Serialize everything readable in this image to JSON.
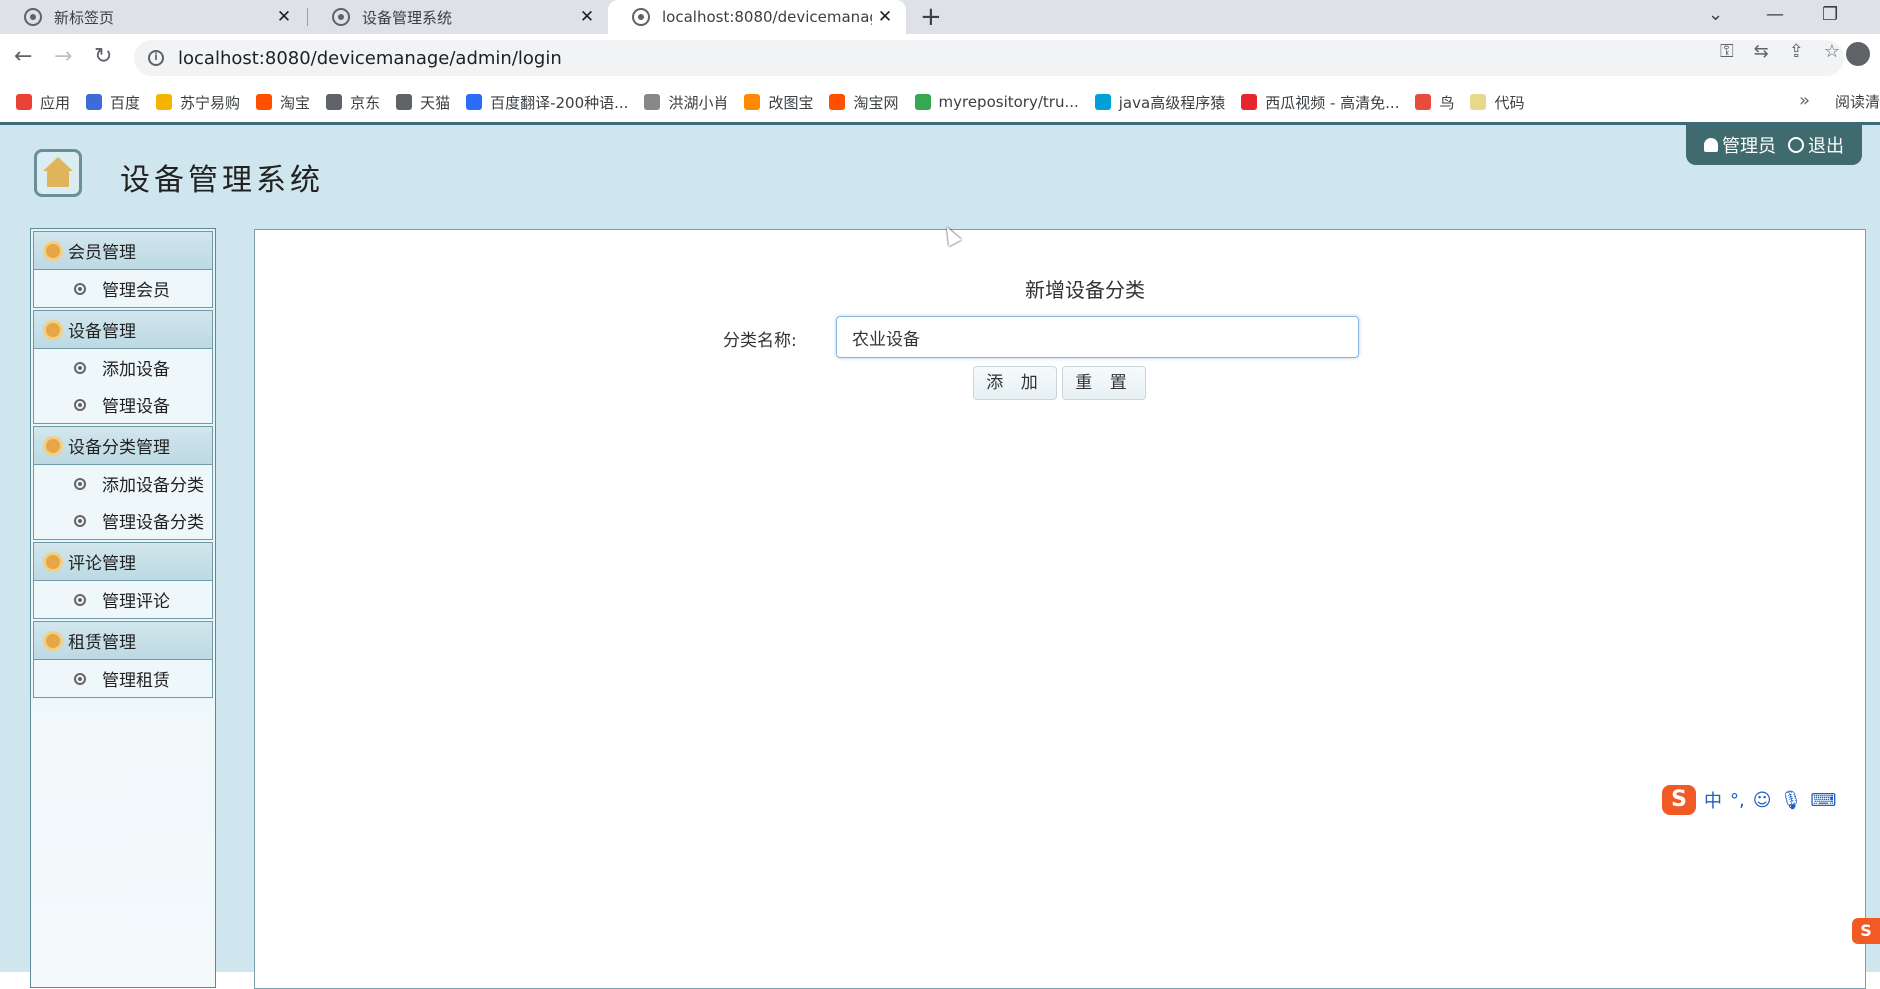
{
  "browser": {
    "tabs": [
      {
        "title": "新标签页"
      },
      {
        "title": "设备管理系统"
      },
      {
        "title": "localhost:8080/devicemanage/"
      }
    ],
    "url": "localhost:8080/devicemanage/admin/login",
    "bookmarks": [
      {
        "label": "应用",
        "color": "#ea4335"
      },
      {
        "label": "百度",
        "color": "#3f6bd8"
      },
      {
        "label": "苏宁易购",
        "color": "#f4b400"
      },
      {
        "label": "淘宝",
        "color": "#ff5000"
      },
      {
        "label": "京东",
        "color": "#5f6368"
      },
      {
        "label": "天猫",
        "color": "#5f6368"
      },
      {
        "label": "百度翻译-200种语...",
        "color": "#2a6cf6"
      },
      {
        "label": "洪湖小肖",
        "color": "#888888"
      },
      {
        "label": "改图宝",
        "color": "#ff8a00"
      },
      {
        "label": "淘宝网",
        "color": "#ff5000"
      },
      {
        "label": "myrepository/tru...",
        "color": "#34a853"
      },
      {
        "label": "java高级程序猿",
        "color": "#00a1d6"
      },
      {
        "label": "西瓜视频 - 高清免...",
        "color": "#e8252c"
      },
      {
        "label": "鸟",
        "color": "#e84a3c"
      },
      {
        "label": "代码",
        "color": "#e8d98a"
      }
    ],
    "more": "»",
    "reading_list": "阅读清"
  },
  "header": {
    "title": "设备管理系统",
    "user_label": "管理员",
    "logout_label": "退出"
  },
  "sidebar": {
    "groups": [
      {
        "label": "会员管理",
        "items": [
          "管理会员"
        ]
      },
      {
        "label": "设备管理",
        "items": [
          "添加设备",
          "管理设备"
        ]
      },
      {
        "label": "设备分类管理",
        "items": [
          "添加设备分类",
          "管理设备分类"
        ]
      },
      {
        "label": "评论管理",
        "items": [
          "管理评论"
        ]
      },
      {
        "label": "租赁管理",
        "items": [
          "管理租赁"
        ]
      }
    ]
  },
  "form": {
    "title": "新增设备分类",
    "label": "分类名称:",
    "value": "农业设备",
    "add_label": "添 加",
    "reset_label": "重 置"
  },
  "ime": {
    "lang": "中",
    "punct": "°,"
  }
}
